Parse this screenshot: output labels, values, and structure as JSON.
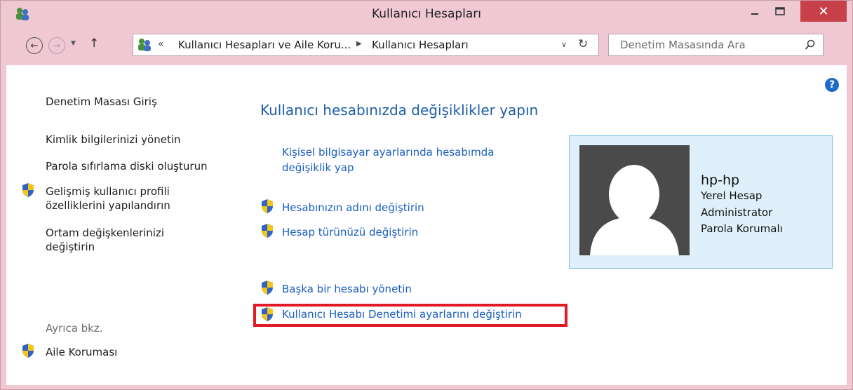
{
  "window": {
    "title": "Kullanıcı Hesapları",
    "close_label": "✕",
    "min_label": "—",
    "max_label": "☐"
  },
  "address": {
    "crumbs": [
      "Kullanıcı Hesapları ve Aile Koru...",
      "Kullanıcı Hesapları"
    ],
    "overflow_label": "«"
  },
  "search": {
    "placeholder": "Denetim Masasında Ara"
  },
  "sidebar": {
    "items": [
      {
        "label": "Denetim Masası Giriş",
        "shield": false
      },
      {
        "label": "Kimlik bilgilerinizi yönetin",
        "shield": false
      },
      {
        "label": "Parola sıfırlama diski oluşturun",
        "shield": false
      },
      {
        "label": "Gelişmiş kullanıcı profili özelliklerini yapılandırın",
        "shield": true
      },
      {
        "label": "Ortam değişkenlerinizi değiştirin",
        "shield": false
      }
    ],
    "see_also_title": "Ayrıca bkz.",
    "see_also_items": [
      {
        "label": "Aile Koruması",
        "shield": true
      }
    ]
  },
  "main": {
    "heading": "Kullanıcı hesabınızda değişiklikler yapın",
    "links": [
      {
        "label": "Kişisel bilgisayar ayarlarında hesabımda değişiklik yap",
        "shield": false
      },
      {
        "label": "Hesabınızın adını değiştirin",
        "shield": true
      },
      {
        "label": "Hesap türünüzü değiştirin",
        "shield": true
      },
      {
        "label": "Başka bir hesabı yönetin",
        "shield": true
      },
      {
        "label": "Kullanıcı Hesabı Denetimi ayarlarını değiştirin",
        "shield": true,
        "highlighted": true
      }
    ]
  },
  "account": {
    "name": "hp-hp",
    "type": "Yerel Hesap",
    "role": "Administrator",
    "protection": "Parola Korumalı"
  },
  "colors": {
    "titlebar": "#f0c8d4",
    "close": "#c8404a",
    "link": "#1a5ec0",
    "highlight": "#e01b25",
    "panel": "#dff0fa"
  }
}
